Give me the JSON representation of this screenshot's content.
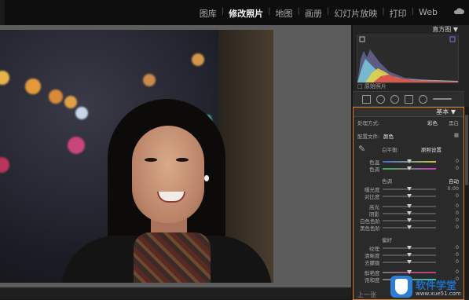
{
  "topbar": {
    "modules": [
      "图库",
      "修改照片",
      "地图",
      "画册",
      "幻灯片放映",
      "打印",
      "Web"
    ],
    "active_module": "修改照片"
  },
  "panel": {
    "histogram_label": "直方图",
    "original_photo_label": "原始照片",
    "basic_label": "基本",
    "treatment_label": "处理方式:",
    "treatment_color": "彩色",
    "treatment_bw": "黑白",
    "profile_label": "配置文件:",
    "profile_value": "颜色",
    "wb_label": "白平衡:",
    "wb_value": "原照设置",
    "temp_label": "色温",
    "tint_label": "色调",
    "tone_label": "色调",
    "auto_label": "自动",
    "exposure_label": "曝光度",
    "exposure_value": "0.00",
    "contrast_label": "对比度",
    "highlights_label": "高光",
    "shadows_label": "阴影",
    "whites_label": "白色色阶",
    "blacks_label": "黑色色阶",
    "presence_label": "偏好",
    "texture_label": "纹理",
    "clarity_label": "清晰度",
    "dehaze_label": "去朦胧",
    "vibrance_label": "鲜艳度",
    "saturation_label": "饱和度",
    "zero": "0"
  },
  "watermark": {
    "text": "软件学堂",
    "url": "www.xue51.com"
  },
  "bottom": {
    "prev_label": "上一张"
  },
  "colors": {
    "accent": "#e07b1f",
    "watermark_blue": "#1f6fc4"
  }
}
